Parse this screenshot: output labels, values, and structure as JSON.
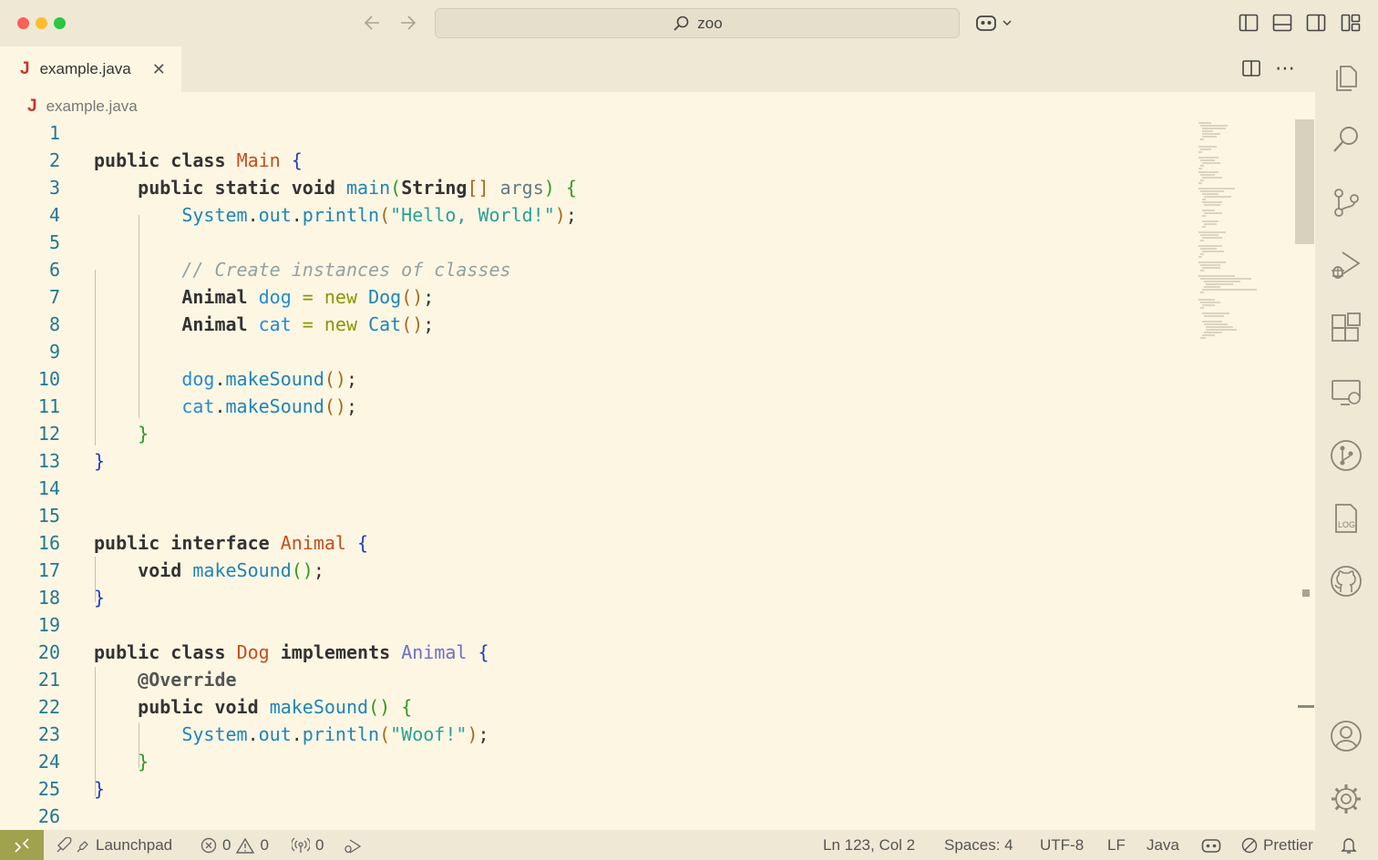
{
  "search": {
    "text": "zoo"
  },
  "tab": {
    "icon": "J",
    "label": "example.java"
  },
  "breadcrumb": {
    "icon": "J",
    "label": "example.java"
  },
  "editor": {
    "line_numbers": [
      "1",
      "2",
      "3",
      "4",
      "5",
      "6",
      "7",
      "8",
      "9",
      "10",
      "11",
      "12",
      "13",
      "14",
      "15",
      "16",
      "17",
      "18",
      "19",
      "20",
      "21",
      "22",
      "23",
      "24",
      "25",
      "26"
    ],
    "code": {
      "kw_public": "public",
      "kw_class": "class",
      "kw_static": "static",
      "kw_void": "void",
      "kw_interface": "interface",
      "kw_implements": "implements",
      "cls_main": "Main",
      "cls_animal": "Animal",
      "cls_dog": "Dog",
      "cls_cat": "Cat",
      "cls_string": "String",
      "fn_main": "main",
      "fn_system": "System",
      "fn_out": "out",
      "fn_println": "println",
      "fn_make_sound": "makeSound",
      "var_args": "args",
      "var_dog": "dog",
      "var_cat": "cat",
      "str_hello": "\"Hello, World!\"",
      "str_woof": "\"Woof!\"",
      "comment": "// Create instances of classes",
      "kw_new": "new",
      "annotation": "@Override"
    }
  },
  "status": {
    "launchpad": "Launchpad",
    "errors": "0",
    "warnings": "0",
    "ports": "0",
    "position": "Ln 123, Col 2",
    "spaces": "Spaces: 4",
    "encoding": "UTF-8",
    "eol": "LF",
    "language": "Java",
    "formatter": "Prettier"
  },
  "colors": {
    "background": "#fdf6e3",
    "chrome": "#eee8d5",
    "remote": "#a1a24e"
  },
  "icons": [
    "explorer-icon",
    "search-icon",
    "source-control-icon",
    "run-debug-icon",
    "extensions-icon",
    "remote-explorer-icon",
    "git-graph-icon",
    "output-log-icon",
    "github-icon",
    "accounts-icon",
    "settings-gear-icon"
  ]
}
